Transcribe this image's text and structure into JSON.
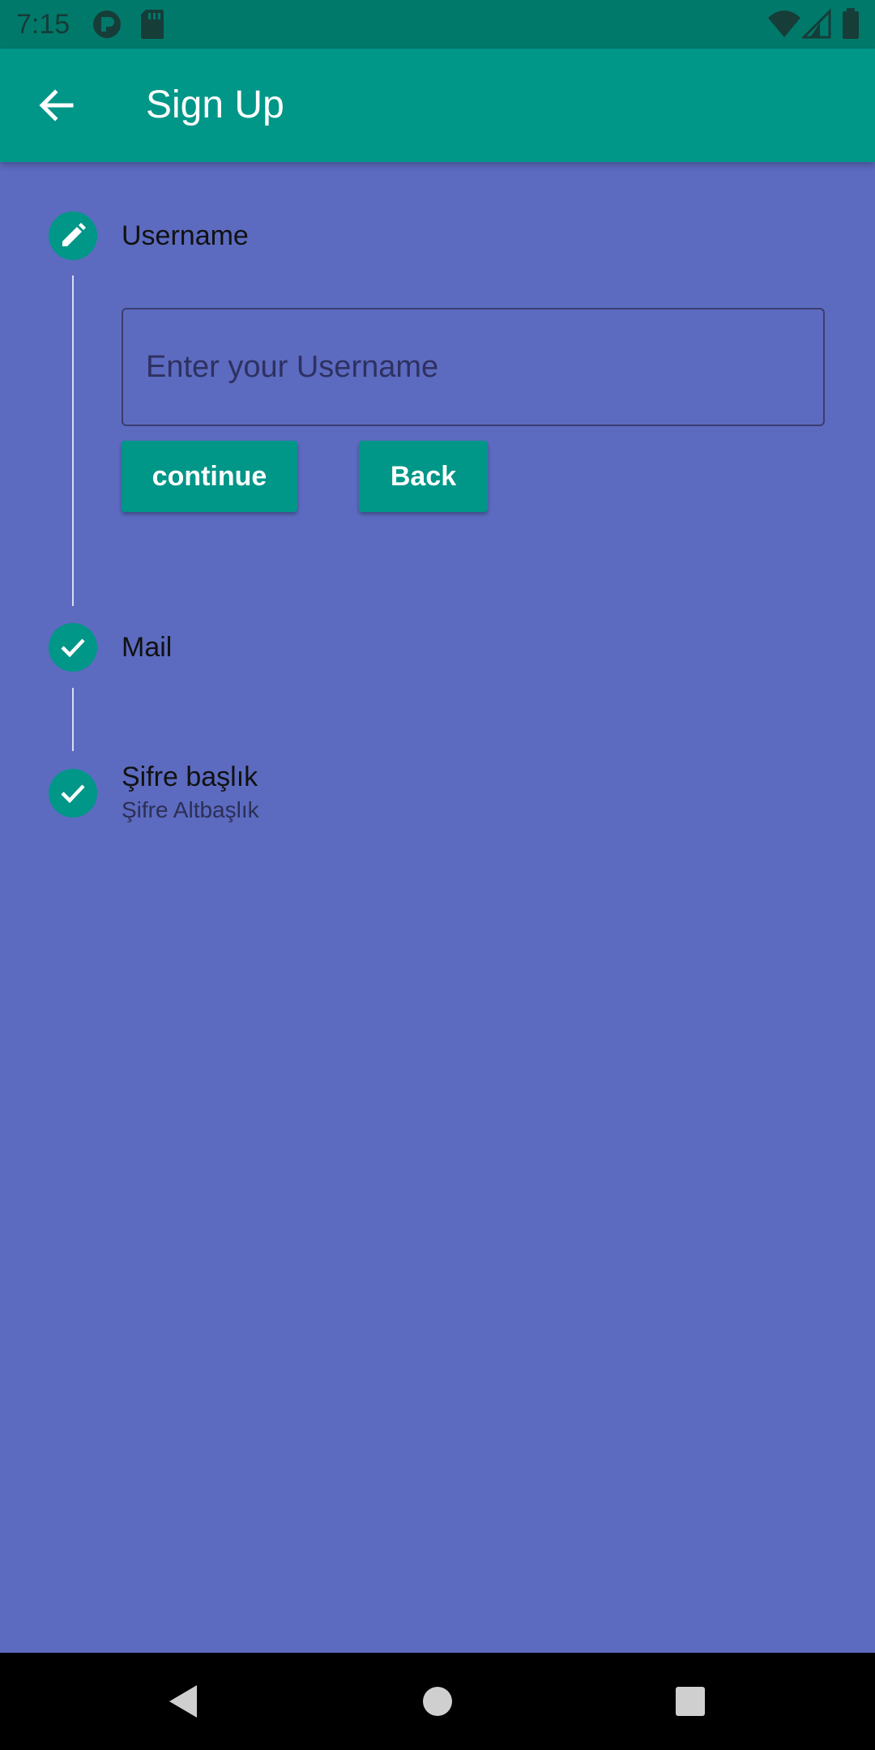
{
  "status_bar": {
    "time": "7:15",
    "icons": [
      "vpn-key-icon",
      "sd-card-icon",
      "wifi-icon",
      "cell-signal-icon",
      "battery-icon"
    ]
  },
  "app_bar": {
    "title": "Sign Up",
    "back_icon": "arrow-back-icon"
  },
  "stepper": {
    "steps": [
      {
        "title": "Username",
        "subtitle": "",
        "state": "editing",
        "icon": "pencil-icon"
      },
      {
        "title": "Mail",
        "subtitle": "",
        "state": "complete",
        "icon": "check-icon"
      },
      {
        "title": "Şifre başlık",
        "subtitle": "Şifre Altbaşlık",
        "state": "complete",
        "icon": "check-icon"
      }
    ],
    "active_step": {
      "input_placeholder": "Enter your Username",
      "input_value": "",
      "continue_label": "continue",
      "back_label": "Back"
    }
  },
  "colors": {
    "background": "#5c6bc0",
    "primary": "#009688",
    "status_bar": "#00796b"
  },
  "nav_bar": {
    "icons": [
      "nav-back-icon",
      "nav-home-icon",
      "nav-recents-icon"
    ]
  }
}
